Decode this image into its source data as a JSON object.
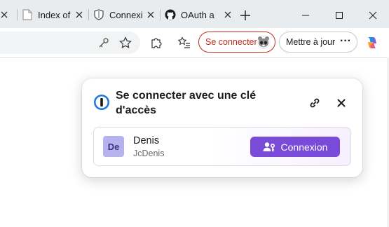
{
  "tabs": [
    {
      "title": "Index of",
      "icon": "file-icon"
    },
    {
      "title": "Connexi",
      "icon": "shield-icon"
    },
    {
      "title": "OAuth a",
      "icon": "github-icon"
    }
  ],
  "toolbar": {
    "sign_in_label": "Se connecter",
    "update_label": "Mettre à jour",
    "more_label": "···"
  },
  "popup": {
    "title": "Se connecter avec une clé d'accès",
    "account": {
      "initials": "De",
      "name": "Denis",
      "username": "JcDenis"
    },
    "connect_label": "Connexion"
  },
  "colors": {
    "accent": "#7a4bd8",
    "signin_red": "#c42b1c",
    "avatar_bg": "#b6b2ee",
    "tabstrip_bg": "#e9ecef"
  }
}
